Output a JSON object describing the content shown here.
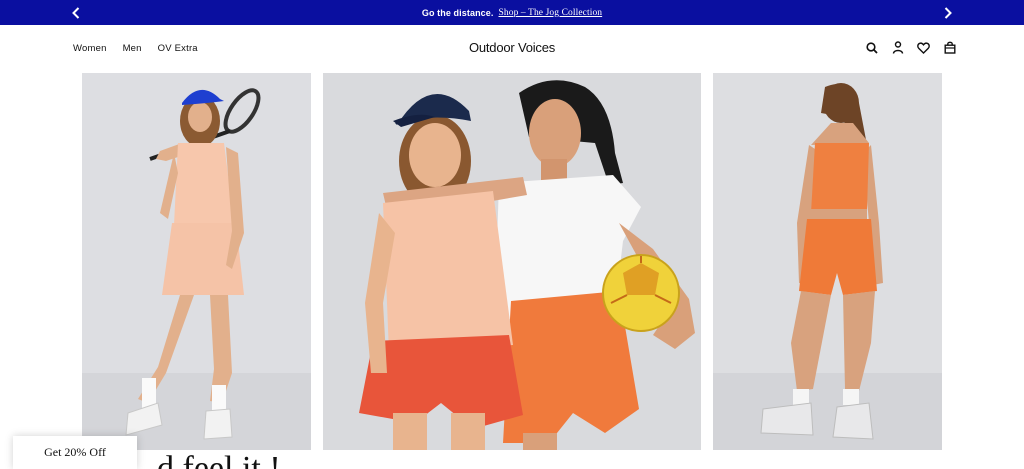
{
  "promo": {
    "text": "Go the distance.",
    "link": "Shop – The Jog Collection"
  },
  "header": {
    "nav": [
      "Women",
      "Men",
      "OV Extra"
    ],
    "logo": "Outdoor Voices",
    "icons": [
      "search-icon",
      "account-icon",
      "wishlist-icon",
      "bag-icon"
    ]
  },
  "colors": {
    "promo_bg": "#0a0fa0",
    "peach": "#f6c3a6",
    "orange": "#f07a3c",
    "red_orange": "#e8553a",
    "navy": "#1b2a4c"
  },
  "discount": {
    "label": "Get 20% Off"
  },
  "headline_peek": "..d feel it !"
}
